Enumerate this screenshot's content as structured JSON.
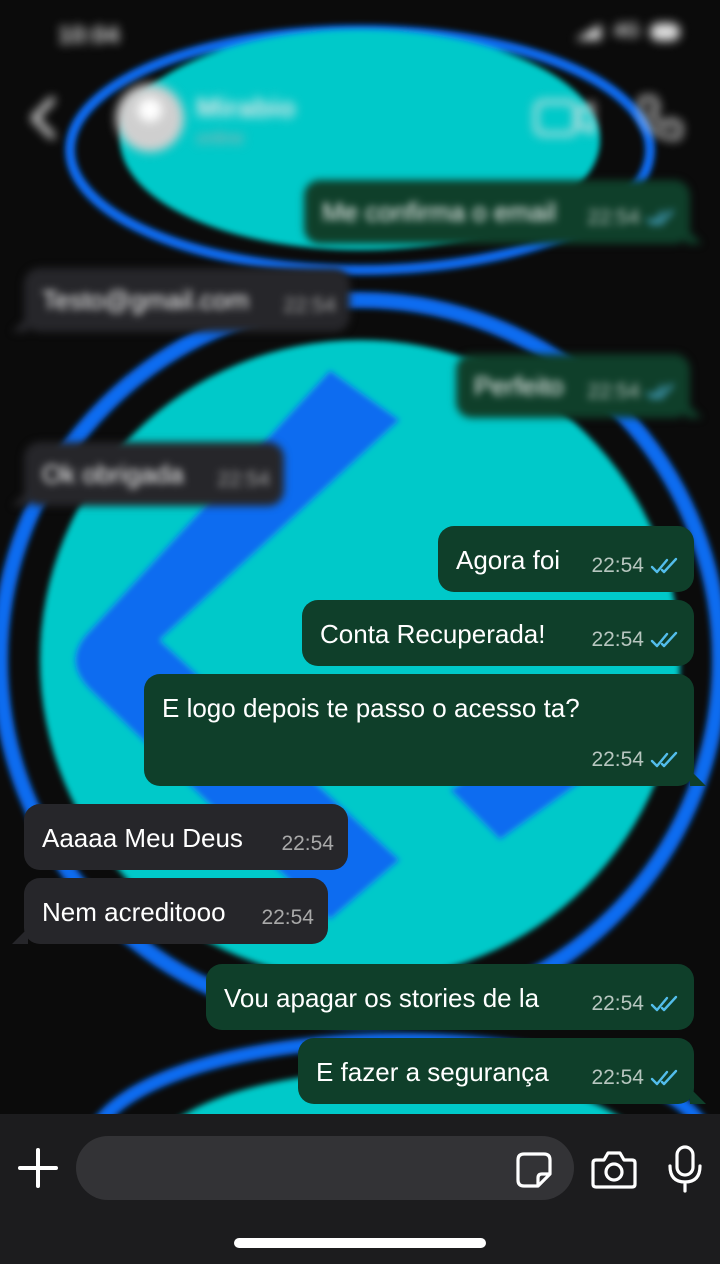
{
  "status_bar": {
    "time": "10:04",
    "signal_text": "4G"
  },
  "header": {
    "contact_name": "Mirabio",
    "contact_status": "online"
  },
  "messages": [
    {
      "direction": "out",
      "text": "Me confirma o email",
      "time": "22:54",
      "read": true,
      "blurred": true
    },
    {
      "direction": "in",
      "text": "Testo@gmail.com",
      "time": "22:54",
      "blurred": true
    },
    {
      "direction": "out",
      "text": "Perfeito",
      "time": "22:54",
      "read": true,
      "blurred": true
    },
    {
      "direction": "in",
      "text": "Ok obrigada",
      "time": "22:54",
      "blurred": true
    },
    {
      "direction": "out",
      "text": "Agora foi",
      "time": "22:54",
      "read": true,
      "blurred": false
    },
    {
      "direction": "out",
      "text": "Conta Recuperada!",
      "time": "22:54",
      "read": true,
      "blurred": false
    },
    {
      "direction": "out",
      "text": "E logo depois te passo o acesso ta?",
      "time": "22:54",
      "read": true,
      "blurred": false
    },
    {
      "direction": "in",
      "text": "Aaaaa Meu Deus",
      "time": "22:54",
      "blurred": false
    },
    {
      "direction": "in",
      "text": "Nem acreditooo",
      "time": "22:54",
      "blurred": false
    },
    {
      "direction": "out",
      "text": "Vou apagar os stories de la",
      "time": "22:54",
      "read": true,
      "blurred": false
    },
    {
      "direction": "out",
      "text": "E fazer a segurança",
      "time": "22:54",
      "read": true,
      "blurred": false
    }
  ],
  "input": {
    "placeholder": ""
  },
  "colors": {
    "wallpaper_cyan": "#00c9c9",
    "wallpaper_blue": "#0a6cf0",
    "bubble_out": "#0f3f2a",
    "bubble_in": "#26262a",
    "read_ticks": "#53bdeb",
    "input_bar": "#1c1c1e"
  },
  "icons": [
    "back-icon",
    "avatar",
    "video-call-icon",
    "phone-icon",
    "plus-icon",
    "sticker-icon",
    "camera-icon",
    "mic-icon",
    "double-check-icon"
  ]
}
